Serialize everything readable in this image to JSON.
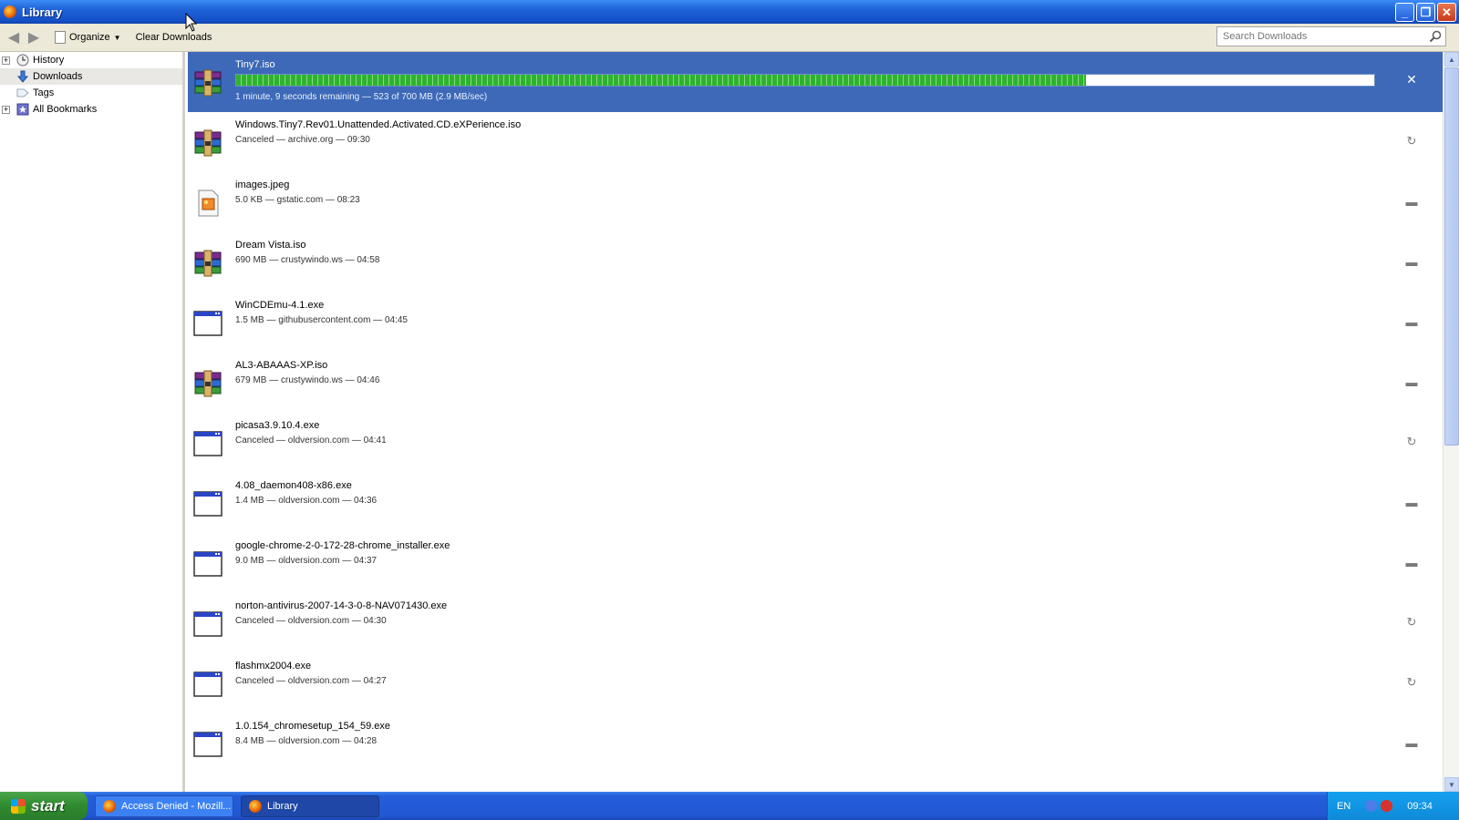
{
  "window": {
    "title": "Library"
  },
  "toolbar": {
    "organize_label": "Organize",
    "clear_label": "Clear Downloads",
    "search_placeholder": "Search Downloads"
  },
  "sidebar": {
    "items": [
      {
        "label": "History",
        "icon": "clock-icon",
        "expandable": true,
        "selected": false
      },
      {
        "label": "Downloads",
        "icon": "download-arrow-icon",
        "expandable": false,
        "selected": true
      },
      {
        "label": "Tags",
        "icon": "tag-icon",
        "expandable": false,
        "selected": false
      },
      {
        "label": "All Bookmarks",
        "icon": "bookmarks-icon",
        "expandable": true,
        "selected": false
      }
    ]
  },
  "downloads": [
    {
      "name": "Tiny7.iso",
      "status": "1 minute, 9 seconds remaining — 523 of 700 MB (2.9 MB/sec)",
      "icon": "archive-icon",
      "progress": 0.747,
      "action": "cancel-icon",
      "active": true
    },
    {
      "name": "Windows.Tiny7.Rev01.Unattended.Activated.CD.eXPerience.iso",
      "status": "Canceled — archive.org — 09:30",
      "icon": "archive-icon",
      "action": "retry-icon"
    },
    {
      "name": "images.jpeg",
      "status": "5.0 KB — gstatic.com — 08:23",
      "icon": "image-file-icon",
      "action": "folder-icon"
    },
    {
      "name": "Dream Vista.iso",
      "status": "690 MB — crustywindo.ws — 04:58",
      "icon": "archive-icon",
      "action": "folder-icon"
    },
    {
      "name": "WinCDEmu-4.1.exe",
      "status": "1.5 MB — githubusercontent.com — 04:45",
      "icon": "exe-file-icon",
      "action": "folder-icon"
    },
    {
      "name": "AL3-ABAAAS-XP.iso",
      "status": "679 MB — crustywindo.ws — 04:46",
      "icon": "archive-icon",
      "action": "folder-icon"
    },
    {
      "name": "picasa3.9.10.4.exe",
      "status": "Canceled — oldversion.com — 04:41",
      "icon": "exe-file-icon",
      "action": "retry-icon"
    },
    {
      "name": "4.08_daemon408-x86.exe",
      "status": "1.4 MB — oldversion.com — 04:36",
      "icon": "exe-file-icon",
      "action": "folder-icon"
    },
    {
      "name": "google-chrome-2-0-172-28-chrome_installer.exe",
      "status": "9.0 MB — oldversion.com — 04:37",
      "icon": "exe-file-icon",
      "action": "folder-icon"
    },
    {
      "name": "norton-antivirus-2007-14-3-0-8-NAV071430.exe",
      "status": "Canceled — oldversion.com — 04:30",
      "icon": "exe-file-icon",
      "action": "retry-icon"
    },
    {
      "name": "flashmx2004.exe",
      "status": "Canceled — oldversion.com — 04:27",
      "icon": "exe-file-icon",
      "action": "retry-icon"
    },
    {
      "name": "1.0.154_chromesetup_154_59.exe",
      "status": "8.4 MB — oldversion.com — 04:28",
      "icon": "exe-file-icon",
      "action": "folder-icon"
    }
  ],
  "taskbar": {
    "start_label": "start",
    "tasks": [
      {
        "label": "Access Denied - Mozill...",
        "active": false
      },
      {
        "label": "Library",
        "active": true
      }
    ],
    "tray": {
      "language": "EN",
      "clock": "09:34"
    }
  }
}
